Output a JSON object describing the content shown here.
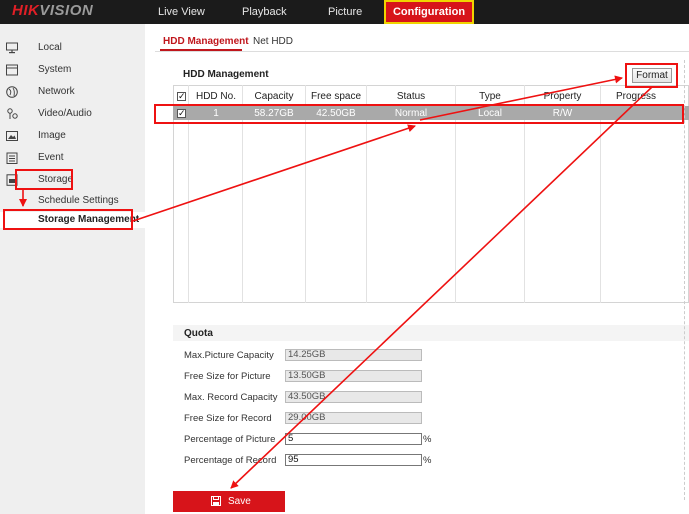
{
  "brand": {
    "name_red": "HIK",
    "name_gray": "VISION"
  },
  "topnav": [
    {
      "label": "Live View",
      "active": false
    },
    {
      "label": "Playback",
      "active": false
    },
    {
      "label": "Picture",
      "active": false
    },
    {
      "label": "Configuration",
      "active": true
    }
  ],
  "sidebar": {
    "items": [
      {
        "label": "Local",
        "icon": "monitor-icon"
      },
      {
        "label": "System",
        "icon": "system-icon"
      },
      {
        "label": "Network",
        "icon": "globe-icon"
      },
      {
        "label": "Video/Audio",
        "icon": "video-audio-icon"
      },
      {
        "label": "Image",
        "icon": "image-icon"
      },
      {
        "label": "Event",
        "icon": "event-icon"
      },
      {
        "label": "Storage",
        "icon": "storage-icon"
      }
    ],
    "subitems": [
      {
        "label": "Schedule Settings",
        "active": false
      },
      {
        "label": "Storage Management",
        "active": true
      }
    ]
  },
  "tabs": [
    {
      "label": "HDD Management",
      "active": true
    },
    {
      "label": "Net HDD",
      "active": false
    }
  ],
  "hdd": {
    "title": "HDD Management",
    "format_label": "Format",
    "columns": [
      "HDD No.",
      "Capacity",
      "Free space",
      "Status",
      "Type",
      "Property",
      "Progress"
    ],
    "rows": [
      {
        "checked": true,
        "hdd_no": "1",
        "capacity": "58.27GB",
        "free_space": "42.50GB",
        "status": "Normal",
        "type": "Local",
        "property": "R/W",
        "progress": ""
      }
    ]
  },
  "quota": {
    "title": "Quota",
    "fields": [
      {
        "label": "Max.Picture Capacity",
        "value": "14.25GB",
        "editable": false,
        "unit": ""
      },
      {
        "label": "Free Size for Picture",
        "value": "13.50GB",
        "editable": false,
        "unit": ""
      },
      {
        "label": "Max. Record Capacity",
        "value": "43.50GB",
        "editable": false,
        "unit": ""
      },
      {
        "label": "Free Size for Record",
        "value": "29.00GB",
        "editable": false,
        "unit": ""
      },
      {
        "label": "Percentage of Picture",
        "value": "5",
        "editable": true,
        "unit": "%"
      },
      {
        "label": "Percentage of Record",
        "value": "95",
        "editable": true,
        "unit": "%"
      }
    ]
  },
  "save_label": "Save",
  "colors": {
    "accent": "#d7141a",
    "annotation": "#ee1111",
    "highlight": "#f0d400"
  }
}
